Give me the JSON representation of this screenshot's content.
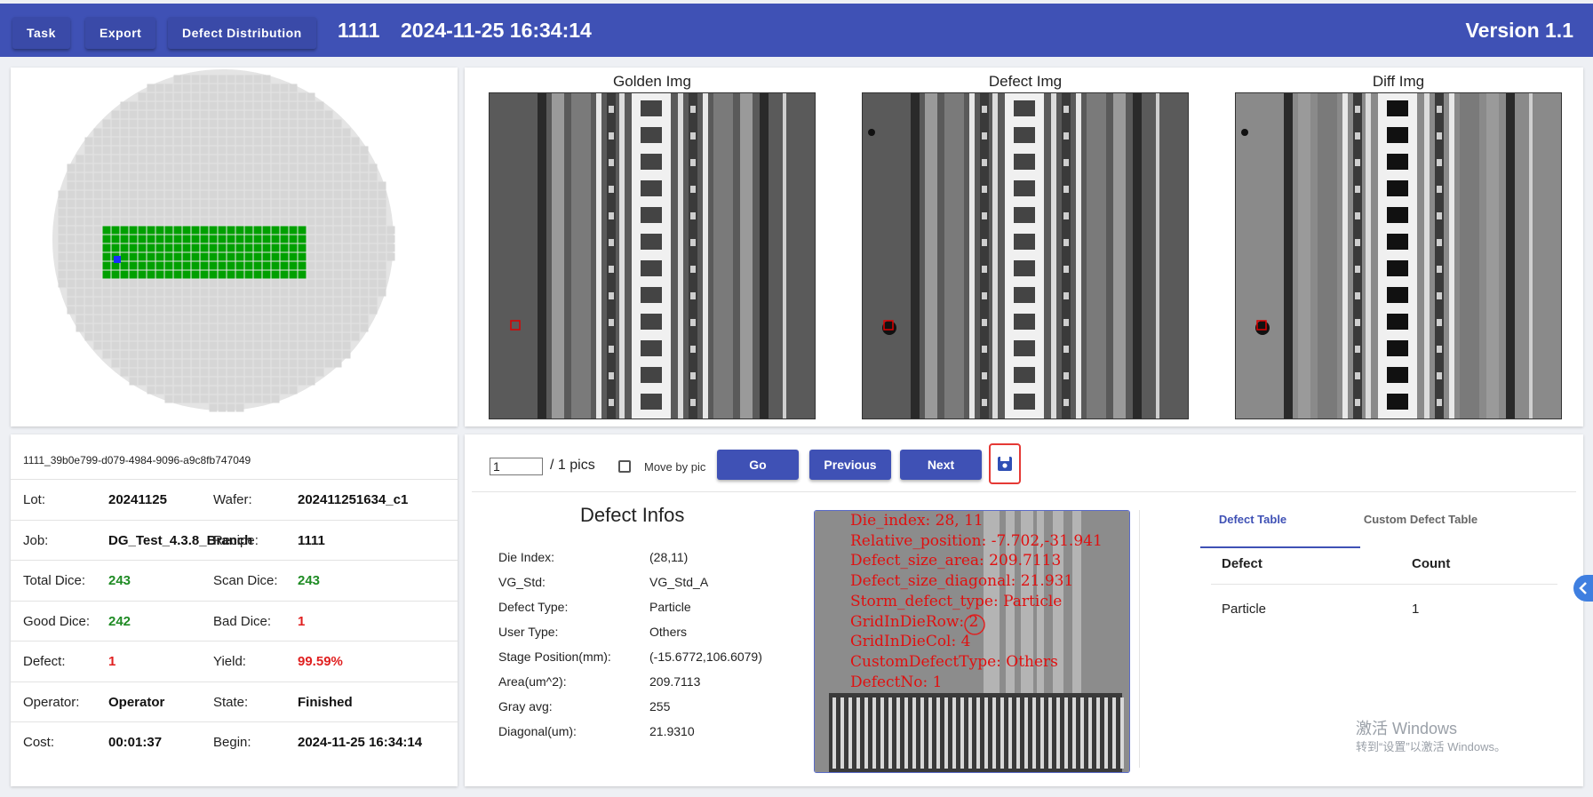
{
  "header": {
    "buttons": [
      "Task",
      "Export",
      "Defect Distribution"
    ],
    "task_id": "1111",
    "timestamp": "2024-11-25 16:34:14",
    "version": "Version 1.1",
    "bar_color": "#3f51b5"
  },
  "wafer_map": {
    "base_color": "#d6d6d6",
    "scanned_color": "#00a000",
    "defect_die_color": "#1a2cff"
  },
  "images": {
    "golden_title": "Golden Img",
    "defect_title": "Defect Img",
    "diff_title": "Diff Img"
  },
  "wafer_info": {
    "uid": "1111_39b0e799-d079-4984-9096-a9c8fb747049",
    "rows": [
      {
        "l1": "Lot:",
        "v1": "20241125",
        "l2": "Wafer:",
        "v2": "202411251634_c1"
      },
      {
        "l1": "Job:",
        "v1": "DG_Test_4.3.8_Branch",
        "l2": "Recipe:",
        "v2": "1111"
      },
      {
        "l1": "Total Dice:",
        "v1": "243",
        "l2": "Scan Dice:",
        "v2": "243"
      },
      {
        "l1": "Good Dice:",
        "v1": "242",
        "l2": "Bad Dice:",
        "v2": "1"
      },
      {
        "l1": "Defect:",
        "v1": "1",
        "l2": "Yield:",
        "v2": "99.59%"
      },
      {
        "l1": "Operator:",
        "v1": "Operator",
        "l2": "State:",
        "v2": "Finished"
      },
      {
        "l1": "Cost:",
        "v1": "00:01:37",
        "l2": "Begin:",
        "v2": "2024-11-25 16:34:14"
      }
    ]
  },
  "navigation": {
    "page_value": "1",
    "total_label": "/ 1 pics",
    "move_by_pic_label": "Move by pic",
    "move_by_pic_checked": false,
    "go_label": "Go",
    "previous_label": "Previous",
    "next_label": "Next",
    "save_icon": "save-icon",
    "accent": "#3f51b5",
    "highlight": "#e53935"
  },
  "defect_infos": {
    "title": "Defect Infos",
    "fields": [
      {
        "label": "Die Index:",
        "value": "(28,11)"
      },
      {
        "label": "VG_Std:",
        "value": "VG_Std_A"
      },
      {
        "label": "Defect Type:",
        "value": "Particle"
      },
      {
        "label": "User Type:",
        "value": "Others"
      },
      {
        "label": "Stage Position(mm):",
        "value": "(-15.6772,106.6079)"
      },
      {
        "label": "Area(um^2):",
        "value": "209.7113"
      },
      {
        "label": "Gray avg:",
        "value": "255"
      },
      {
        "label": "Diagonal(um):",
        "value": "21.9310"
      }
    ]
  },
  "overlay_text": [
    "Die_index: 28, 11",
    "Relative_position: -7.702,-31.941",
    "Defect_size_area: 209.7113",
    "Defect_size_diagonal: 21.931",
    "Storm_defect_type: Particle",
    "GridInDieRow: 2",
    "GridInDieCol: 4",
    "CustomDefectType: Others",
    "DefectNo: 1"
  ],
  "defect_table": {
    "tabs": [
      "Defect Table",
      "Custom Defect Table"
    ],
    "active_tab": 0,
    "headers": [
      "Defect",
      "Count"
    ],
    "rows": [
      {
        "defect": "Particle",
        "count": "1"
      }
    ]
  },
  "watermark": {
    "line1": "激活 Windows",
    "line2": "转到“设置”以激活 Windows。"
  }
}
